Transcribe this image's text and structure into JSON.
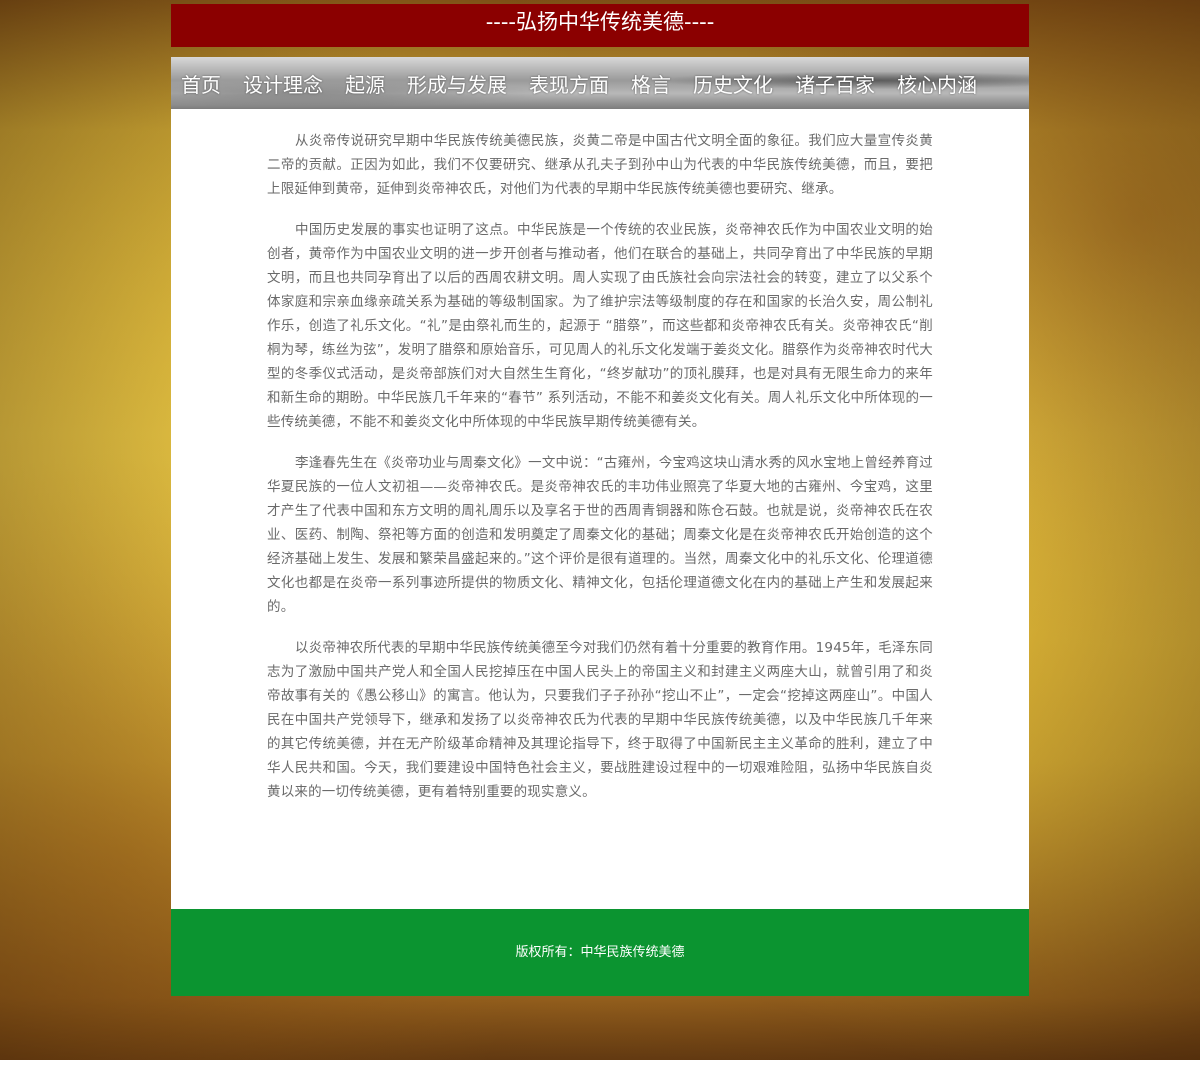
{
  "header": {
    "title": "----弘扬中华传统美德----"
  },
  "nav": {
    "items": [
      {
        "label": "首页"
      },
      {
        "label": "设计理念"
      },
      {
        "label": "起源"
      },
      {
        "label": "形成与发展"
      },
      {
        "label": "表现方面"
      },
      {
        "label": "格言"
      },
      {
        "label": "历史文化"
      },
      {
        "label": "诸子百家"
      },
      {
        "label": "核心内涵"
      }
    ]
  },
  "article": {
    "paragraphs": [
      "从炎帝传说研究早期中华民族传统美德民族，炎黄二帝是中国古代文明全面的象征。我们应大量宣传炎黄二帝的贡献。正因为如此，我们不仅要研究、继承从孔夫子到孙中山为代表的中华民族传统美德，而且，要把上限延伸到黄帝，延伸到炎帝神农氏，对他们为代表的早期中华民族传统美德也要研究、继承。",
      "中国历史发展的事实也证明了这点。中华民族是一个传统的农业民族，炎帝神农氏作为中国农业文明的始创者，黄帝作为中国农业文明的进一步开创者与推动者，他们在联合的基础上，共同孕育出了中华民族的早期文明，而且也共同孕育出了以后的西周农耕文明。周人实现了由氏族社会向宗法社会的转变，建立了以父系个体家庭和宗亲血缘亲疏关系为基础的等级制国家。为了维护宗法等级制度的存在和国家的长治久安，周公制礼作乐，创造了礼乐文化。“礼”是由祭礼而生的，起源于 “腊祭”，而这些都和炎帝神农氏有关。炎帝神农氏“削桐为琴，练丝为弦”，发明了腊祭和原始音乐，可见周人的礼乐文化发端于姜炎文化。腊祭作为炎帝神农时代大型的冬季仪式活动，是炎帝部族们对大自然生生育化，“终岁献功”的顶礼膜拜，也是对具有无限生命力的来年和新生命的期盼。中华民族几千年来的“春节” 系列活动，不能不和姜炎文化有关。周人礼乐文化中所体现的一些传统美德，不能不和姜炎文化中所体现的中华民族早期传统美德有关。",
      "李逢春先生在《炎帝功业与周秦文化》一文中说：“古雍州，今宝鸡这块山清水秀的风水宝地上曾经养育过华夏民族的一位人文初祖——炎帝神农氏。是炎帝神农氏的丰功伟业照亮了华夏大地的古雍州、今宝鸡，这里才产生了代表中国和东方文明的周礼周乐以及享名于世的西周青铜器和陈仓石鼓。也就是说，炎帝神农氏在农业、医药、制陶、祭祀等方面的创造和发明奠定了周秦文化的基础；周秦文化是在炎帝神农氏开始创造的这个经济基础上发生、发展和繁荣昌盛起来的。”这个评价是很有道理的。当然，周秦文化中的礼乐文化、伦理道德文化也都是在炎帝一系列事迹所提供的物质文化、精神文化，包括伦理道德文化在内的基础上产生和发展起来的。",
      "以炎帝神农所代表的早期中华民族传统美德至今对我们仍然有着十分重要的教育作用。1945年，毛泽东同志为了激励中国共产党人和全国人民挖掉压在中国人民头上的帝国主义和封建主义两座大山，就曾引用了和炎帝故事有关的《愚公移山》的寓言。他认为，只要我们子子孙孙“挖山不止”，一定会“挖掉这两座山”。中国人民在中国共产党领导下，继承和发扬了以炎帝神农氏为代表的早期中华民族传统美德，以及中华民族几千年来的其它传统美德，并在无产阶级革命精神及其理论指导下，终于取得了中国新民主主义革命的胜利，建立了中华人民共和国。今天，我们要建设中国特色社会主义，要战胜建设过程中的一切艰难险阻，弘扬中华民族自炎黄以来的一切传统美德，更有着特别重要的现实意义。"
    ]
  },
  "footer": {
    "copyright": "版权所有：中华民族传统美德"
  },
  "colors": {
    "header_bg": "#8b0000",
    "footer_bg": "#0b9430",
    "content_bg": "#ffffff",
    "text": "#6a6a6a"
  }
}
